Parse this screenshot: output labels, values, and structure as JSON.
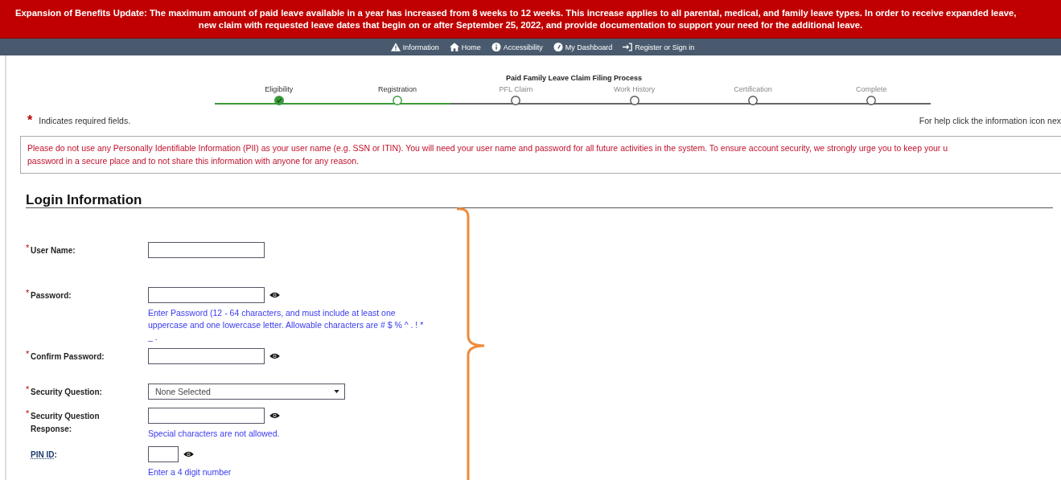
{
  "banner": {
    "lines": [
      "**Expansion of Benefits Update:** The maximum amount of paid leave available in a year has increased from 8 weeks to 12 weeks. This increase applies to all parental, medical, and family leave types. In order to receive expanded leave,",
      "new claim with requested leave dates that begin on or after September 25, 2022, and provide documentation to support your need for the additional leave."
    ]
  },
  "nav": [
    {
      "label": "Information"
    },
    {
      "label": "Home"
    },
    {
      "label": "Accessibility"
    },
    {
      "label": "My Dashboard"
    },
    {
      "label": "Register or Sign in"
    }
  ],
  "process": {
    "title": "Paid Family Leave Claim Filing Process",
    "steps": [
      {
        "label": "Eligibility",
        "completed": true,
        "current": false
      },
      {
        "label": "Registration",
        "completed": false,
        "current": true
      },
      {
        "label": "PFL Claim",
        "completed": false,
        "current": false
      },
      {
        "label": "Work History",
        "completed": false,
        "current": false
      },
      {
        "label": "Certification",
        "completed": false,
        "current": false
      },
      {
        "label": "Complete",
        "completed": false,
        "current": false
      }
    ]
  },
  "required_note": {
    "mark": "*",
    "text": "Indicates required fields."
  },
  "help_text": "For help click the information icon nex",
  "pii_notice": [
    "Please do not use any Personally Identifiable Information (PII) as your user name (e.g. SSN or ITIN). You will need your user name and password for all future activities in the system. To ensure account security, we strongly urge you to keep your u",
    "password in a secure place and to not share this information with anyone for any reason."
  ],
  "section_title": "Login Information",
  "fields": [
    {
      "label": "User Name:",
      "kind": "text",
      "required": true,
      "reveal": false
    },
    {
      "label": "Password:",
      "kind": "text",
      "required": true,
      "reveal": true,
      "hint": "Enter Password (12 - 64 characters, and must include at least one uppercase and one lowercase letter. Allowable characters are # $ % ^ . ! * _ ."
    },
    {
      "label": "Confirm Password:",
      "kind": "text",
      "required": true,
      "reveal": true
    },
    {
      "label": "Security Question:",
      "kind": "select",
      "required": true,
      "reveal": false,
      "value": "None Selected"
    },
    {
      "label": "Security Question Response:",
      "kind": "text",
      "required": true,
      "reveal": true,
      "hint": "Special characters are not allowed."
    },
    {
      "label": "PIN ID",
      "suffix": ":",
      "kind": "pin",
      "required": false,
      "reveal": true,
      "hint": "Enter a 4 digit number"
    }
  ]
}
